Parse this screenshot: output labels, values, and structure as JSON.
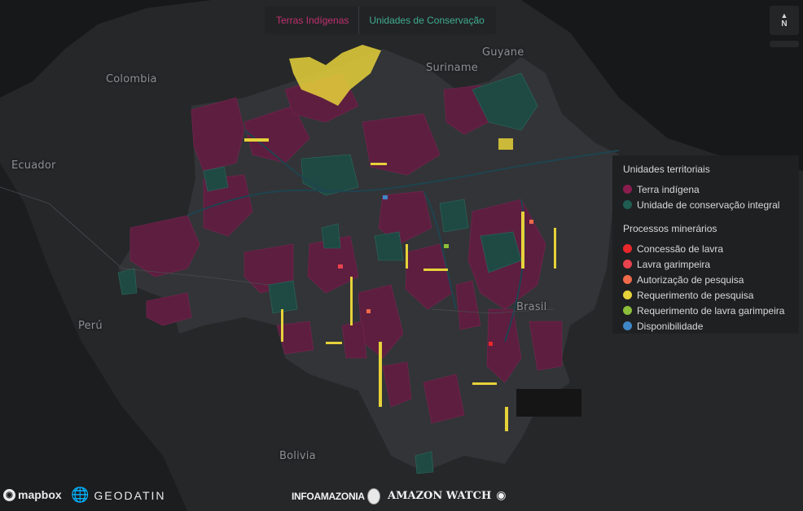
{
  "tabs": {
    "terras_indigenas": "Terras Indígenas",
    "unidades_conservacao": "Unidades de Conservação"
  },
  "compass": {
    "label": "N",
    "icon": "north-arrow-icon"
  },
  "map_labels": {
    "countries": {
      "colombia": "Colombia",
      "suriname": "Suriname",
      "guyane": "Guyane",
      "ecuador": "Ecuador",
      "peru": "Perú",
      "brasil": "Brasil",
      "bolivia": "Bolivia"
    }
  },
  "legend": {
    "section1_title": "Unidades territoriais",
    "territorial": [
      {
        "label": "Terra indígena",
        "color": "#8a1d4e"
      },
      {
        "label": "Unidade de conservação integral",
        "color": "#1f5d52"
      }
    ],
    "section2_title": "Processos minerários",
    "mining": [
      {
        "label": "Concessão de lavra",
        "color": "#e8272b"
      },
      {
        "label": "Lavra garimpeira",
        "color": "#e8434e"
      },
      {
        "label": "Autorização de pesquisa",
        "color": "#ef6a4a"
      },
      {
        "label": "Requerimento de pesquisa",
        "color": "#e6d23a"
      },
      {
        "label": "Requerimento de lavra garimpeira",
        "color": "#8cbf3a"
      },
      {
        "label": "Disponibilidade",
        "color": "#3f86c6"
      }
    ]
  },
  "colors": {
    "background": "#1b1c1e",
    "land": "#2b2c2e",
    "amazon_region": "#333436",
    "indigenous": "#5e1e40",
    "conservation": "#1f4a44",
    "rivers": "#1d3e4a",
    "requerimento": "#e6d23a"
  },
  "footer": {
    "mapbox": "mapbox",
    "geodatin": "GEODATIN",
    "infoamazonia": "INFOAMAZONIA",
    "amazonwatch": "AMAZON WATCH"
  }
}
